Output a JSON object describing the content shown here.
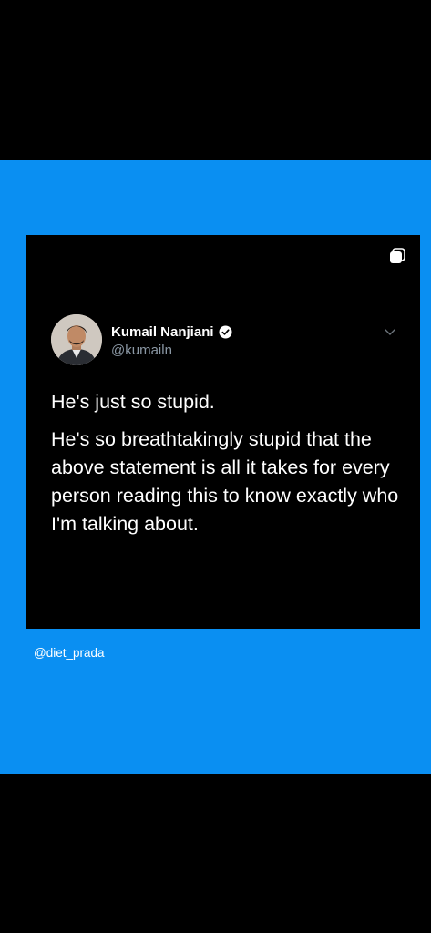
{
  "tweet": {
    "display_name": "Kumail Nanjiani",
    "handle": "@kumailn",
    "paragraphs": [
      "He's just so stupid.",
      "He's so breathtakingly stupid that the above statement is all it takes for every person reading this to know exactly who I'm talking about."
    ],
    "verified": true,
    "icons": {
      "multi_image": "multiple-images-icon",
      "verified": "verified-badge-icon",
      "more": "chevron-down-icon",
      "avatar": "profile-photo"
    }
  },
  "watermark": "@diet_prada",
  "colors": {
    "background": "#000000",
    "panel_blue": "#0a8ff2",
    "handle_grey": "#8b98a5",
    "text_white": "#ffffff"
  }
}
